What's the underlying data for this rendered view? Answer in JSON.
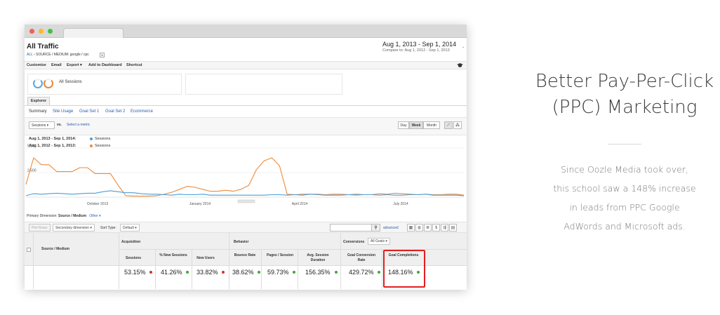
{
  "ga": {
    "title": "All Traffic",
    "breadcrumb_prefix": "ALL",
    "breadcrumb_rest": "› SOURCE / MEDIUM: google / cpc",
    "breadcrumb_caret": "▾",
    "date_range": "Aug 1, 2013 - Sep 1, 2014",
    "compare": "Compare to: Aug 1, 2012 - Sep 1, 2013",
    "date_caret": "⌄",
    "toolbar": [
      "Customize",
      "Email",
      "Export ▾",
      "Add to Dashboard",
      "Shortcut"
    ],
    "cap_icon": "graduation-cap-icon",
    "segment": "All Sessions",
    "explorer_tab": "Explorer",
    "subtabs": [
      "Summary",
      "Site Usage",
      "Goal Set 1",
      "Goal Set 2",
      "Ecommerce"
    ],
    "metric": "Sessions",
    "vs": "vs.",
    "select_metric": "Select a metric",
    "granularity": [
      "Day",
      "Week",
      "Month"
    ],
    "legend": [
      {
        "range": "Aug 1, 2013 - Sep 1, 2014:",
        "name": "Sessions",
        "color": "#4a9fd8"
      },
      {
        "range": "Aug 1, 2012 - Sep 1, 2013:",
        "name": "Sessions",
        "color": "#ee8a3a"
      }
    ],
    "primary_dimension_label": "Primary Dimension:",
    "primary_dimension_value": "Source / Medium",
    "primary_dimension_other": "Other ▾",
    "plot_rows": "Plot Rows",
    "secondary_dimension": "Secondary dimension ▾",
    "sort_type_label": "Sort Type:",
    "sort_type": "Default ▾",
    "advanced": "advanced",
    "table": {
      "dimension_header": "Source / Medium",
      "groups": {
        "acquisition": "Acquisition",
        "behavior": "Behavior",
        "conversions": "Conversions"
      },
      "goals_select": "All Goals ▾",
      "columns": [
        "Sessions",
        "% New Sessions",
        "New Users",
        "Bounce Rate",
        "Pages / Session",
        "Avg. Session Duration",
        "Goal Conversion Rate",
        "Goal Completions"
      ],
      "values": [
        "53.15%",
        "41.26%",
        "33.82%",
        "38.62%",
        "59.73%",
        "156.35%",
        "429.72%",
        "148.16%"
      ]
    }
  },
  "chart_data": {
    "type": "line",
    "title": "",
    "xlabel": "",
    "ylabel": "",
    "ylim": [
      0,
      5000
    ],
    "y_ticks": [
      "5,000",
      "2,500"
    ],
    "x_tick_labels": [
      "October 2013",
      "January 2014",
      "April 2014",
      "July 2014"
    ],
    "series": [
      {
        "name": "Sessions",
        "period": "Aug 1, 2013 - Sep 1, 2014",
        "color": "#4a9fd8",
        "values": [
          150,
          350,
          300,
          350,
          400,
          350,
          300,
          350,
          400,
          400,
          550,
          650,
          550,
          450,
          450,
          350,
          300,
          300,
          250,
          200,
          300,
          250,
          250,
          300,
          200,
          200,
          200,
          200,
          200,
          200,
          200,
          200,
          250,
          250,
          200,
          250,
          200,
          300,
          250,
          200,
          200,
          200,
          250,
          300,
          250,
          250,
          200,
          250,
          200,
          200,
          250,
          250,
          300,
          200,
          200,
          200,
          200,
          150
        ]
      },
      {
        "name": "Sessions",
        "period": "Aug 1, 2012 - Sep 1, 2013",
        "color": "#ee8a3a",
        "values": [
          1300,
          4000,
          3300,
          3300,
          2600,
          2600,
          2600,
          3000,
          3000,
          2400,
          2400,
          2400,
          1200,
          150,
          100,
          100,
          100,
          150,
          300,
          500,
          800,
          1100,
          1000,
          800,
          600,
          600,
          700,
          600,
          800,
          1200,
          2800,
          3700,
          4000,
          3200,
          300,
          250,
          300,
          300,
          300,
          250,
          300,
          300,
          250,
          200,
          250,
          250,
          350,
          300,
          400,
          350,
          300,
          250,
          300,
          250,
          250,
          300,
          300,
          200
        ]
      }
    ]
  },
  "marketing": {
    "headline": [
      "Better Pay-Per-Click",
      "(PPC) Marketing"
    ],
    "body": [
      "Since Oozle Media took over,",
      "this school saw a 148% increase",
      "in leads from PPC Google",
      "AdWords and Microsoft ads."
    ]
  },
  "colors": {
    "highlight": "#e41e1e",
    "link": "#2a5db0"
  }
}
